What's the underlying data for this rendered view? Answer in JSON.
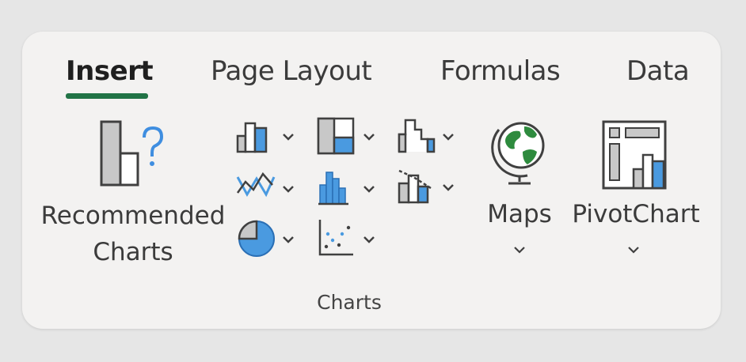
{
  "tabs": [
    {
      "label": "Insert",
      "active": true
    },
    {
      "label": "Page Layout",
      "active": false
    },
    {
      "label": "Formulas",
      "active": false
    },
    {
      "label": "Data",
      "active": false
    }
  ],
  "recommended": {
    "line1": "Recommended",
    "line2": "Charts",
    "icon": "recommended-charts-icon"
  },
  "chart_buttons": [
    {
      "icon": "column-chart-icon"
    },
    {
      "icon": "hierarchy-chart-icon"
    },
    {
      "icon": "waterfall-chart-icon"
    },
    {
      "icon": "line-chart-icon"
    },
    {
      "icon": "statistic-chart-icon"
    },
    {
      "icon": "combo-chart-icon"
    },
    {
      "icon": "pie-chart-icon"
    },
    {
      "icon": "scatter-chart-icon"
    }
  ],
  "maps": {
    "label": "Maps",
    "icon": "globe-icon"
  },
  "pivotchart": {
    "label": "PivotChart",
    "icon": "pivotchart-icon"
  },
  "group_label": "Charts",
  "colors": {
    "accent": "#217346",
    "blue": "#4a9ae0",
    "gray": "#c8c8c8",
    "outline": "#404040"
  }
}
